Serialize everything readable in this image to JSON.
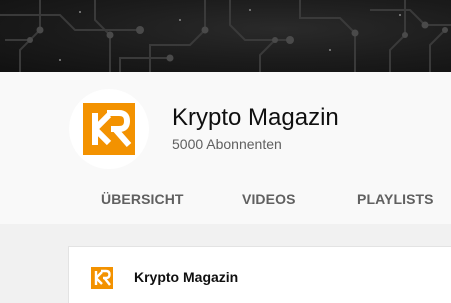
{
  "channel": {
    "title": "Krypto Magazin",
    "subscribers": "5000 Abonnenten"
  },
  "tabs": [
    {
      "label": "ÜBERSICHT"
    },
    {
      "label": "VIDEOS"
    },
    {
      "label": "PLAYLISTS"
    }
  ],
  "section": {
    "title": "Krypto Magazin"
  },
  "icons": {
    "logo": "kr-logo-icon"
  },
  "colors": {
    "brand_orange": "#f39200",
    "banner_dark": "#1b1b1b",
    "header_bg": "#f9f9f9",
    "content_bg": "#f1f1f1",
    "tab_text": "#606060",
    "subtitle_text": "#606060"
  }
}
